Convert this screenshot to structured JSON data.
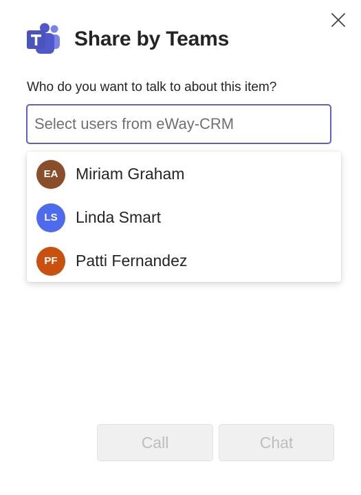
{
  "dialog": {
    "title": "Share by Teams",
    "prompt": "Who do you want to talk to about this item?"
  },
  "search": {
    "value": "",
    "placeholder": "Select users from eWay-CRM"
  },
  "users": [
    {
      "initials": "EA",
      "name": "Miriam Graham",
      "color": "#8a4f2a"
    },
    {
      "initials": "LS",
      "name": "Linda Smart",
      "color": "#4f6bed"
    },
    {
      "initials": "PF",
      "name": "Patti Fernandez",
      "color": "#ca5010"
    }
  ],
  "buttons": {
    "call_label": "Call",
    "chat_label": "Chat",
    "enabled": false
  },
  "colors": {
    "accent": "#5b5fc7",
    "teams_logo_dark": "#4b53bc",
    "teams_logo_light": "#7b83eb",
    "disabled_bg": "#f0f0f0",
    "disabled_text": "#bdbdbd"
  },
  "icons": {
    "close": "close-icon",
    "app_logo": "teams-logo-icon"
  }
}
